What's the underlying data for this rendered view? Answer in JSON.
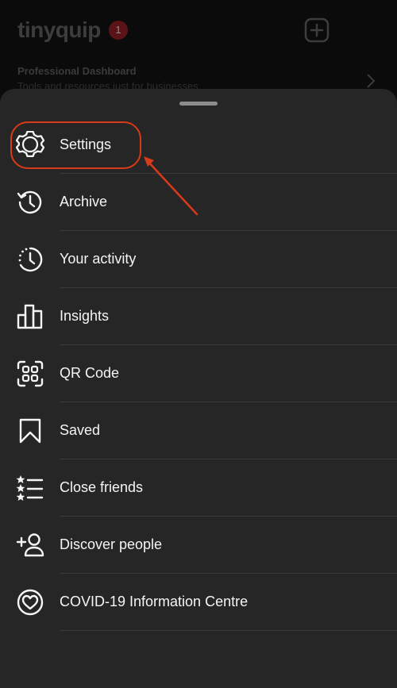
{
  "header": {
    "brand": "tinyquip",
    "notification_count": "1",
    "professional_dashboard_title": "Professional Dashboard",
    "professional_dashboard_subtitle": "Tools and resources just for businesses"
  },
  "sheet": {
    "items": [
      {
        "label": "Settings",
        "icon": "settings-gear-icon"
      },
      {
        "label": "Archive",
        "icon": "archive-clock-icon"
      },
      {
        "label": "Your activity",
        "icon": "activity-clock-icon"
      },
      {
        "label": "Insights",
        "icon": "insights-bar-chart-icon"
      },
      {
        "label": "QR Code",
        "icon": "qr-code-icon"
      },
      {
        "label": "Saved",
        "icon": "bookmark-icon"
      },
      {
        "label": "Close friends",
        "icon": "close-friends-list-icon"
      },
      {
        "label": "Discover people",
        "icon": "add-person-icon"
      },
      {
        "label": "COVID-19 Information Centre",
        "icon": "heart-circle-icon"
      }
    ]
  },
  "annotation": {
    "highlight_color": "#d83a1a"
  },
  "colors": {
    "sheet_background": "#262626",
    "text": "#f5f5f5",
    "divider": "#3a3a3a"
  }
}
